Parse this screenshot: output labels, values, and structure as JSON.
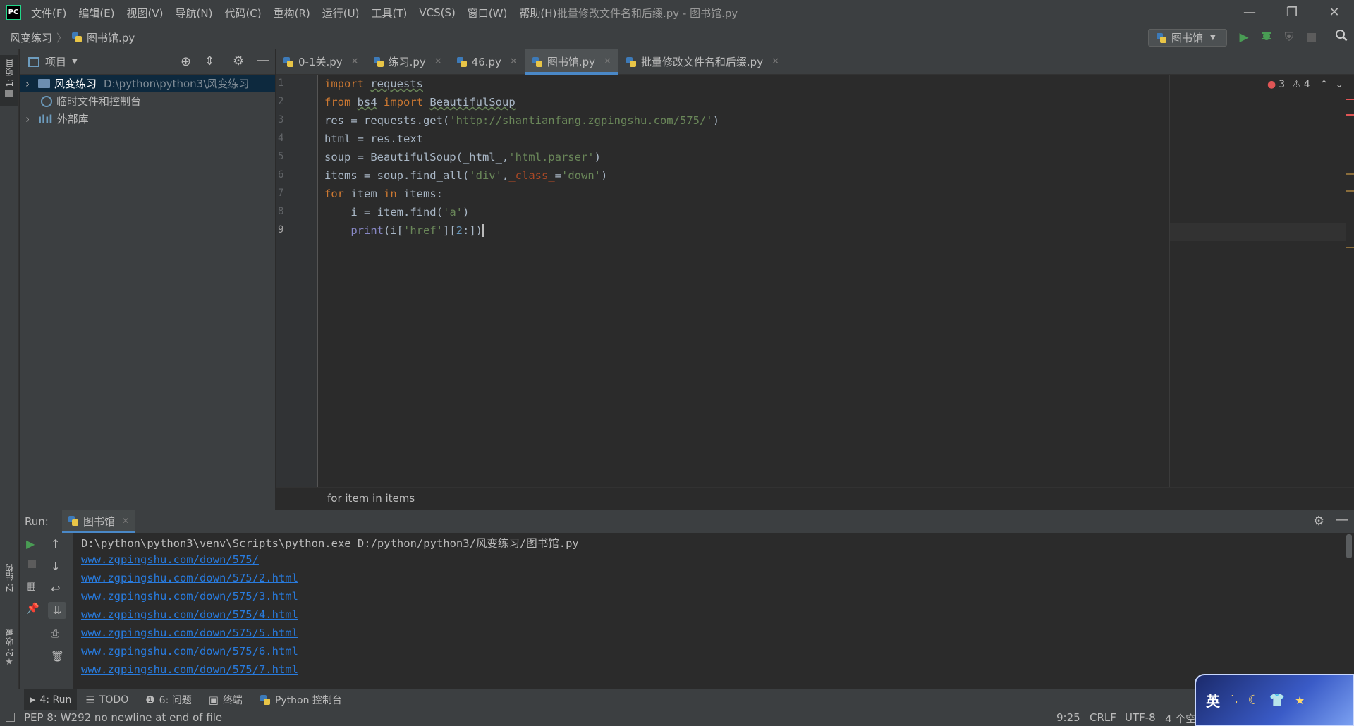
{
  "app": {
    "logo_text": "PC",
    "window_title": "批量修改文件名和后缀.py - 图书馆.py"
  },
  "menu": [
    "文件(F)",
    "编辑(E)",
    "视图(V)",
    "导航(N)",
    "代码(C)",
    "重构(R)",
    "运行(U)",
    "工具(T)",
    "VCS(S)",
    "窗口(W)",
    "帮助(H)"
  ],
  "window_controls": {
    "minimize": "—",
    "restore": "❐",
    "close": "✕"
  },
  "navbar": {
    "project": "风变练习",
    "separator": "〉",
    "file": "图书馆.py",
    "run_config": "图书馆"
  },
  "left_stripe": {
    "project_label": "1: 项目",
    "structure_label": "Z: 结构",
    "favorites_label": "2: 收藏"
  },
  "project_panel": {
    "title": "项目",
    "tree": [
      {
        "label": "风变练习",
        "path": "D:\\python\\python3\\风变练习",
        "arrow": "›",
        "icon": "folder-icon"
      },
      {
        "label": "临时文件和控制台",
        "path": "",
        "arrow": "",
        "icon": "scratch-icon"
      },
      {
        "label": "外部库",
        "path": "",
        "arrow": "›",
        "icon": "library-icon"
      }
    ]
  },
  "tabs": [
    {
      "label": "0-1关.py",
      "active": false
    },
    {
      "label": "练习.py",
      "active": false
    },
    {
      "label": "46.py",
      "active": false
    },
    {
      "label": "图书馆.py",
      "active": true
    },
    {
      "label": "批量修改文件名和后缀.py",
      "active": false
    }
  ],
  "editor": {
    "line_numbers": [
      "1",
      "2",
      "3",
      "4",
      "5",
      "6",
      "7",
      "8",
      "9"
    ],
    "lines": [
      "import requests",
      "from bs4 import BeautifulSoup",
      "res = requests.get('http://shantianfang.zgpingshu.com/575/')",
      "html = res.text",
      "soup = BeautifulSoup(_html_,'html.parser')",
      "items = soup.find_all('div',_class_='down')",
      "for item in items:",
      "    i = item.find('a')",
      "    print(i['href'][2:])"
    ],
    "errors": "3",
    "warnings": "4",
    "breadcrumb": "for item in items"
  },
  "run": {
    "label": "Run:",
    "tab": "图书馆",
    "output": [
      "D:\\python\\python3\\venv\\Scripts\\python.exe D:/python/python3/风变练习/图书馆.py",
      "www.zgpingshu.com/down/575/",
      "www.zgpingshu.com/down/575/2.html",
      "www.zgpingshu.com/down/575/3.html",
      "www.zgpingshu.com/down/575/4.html",
      "www.zgpingshu.com/down/575/5.html",
      "www.zgpingshu.com/down/575/6.html",
      "www.zgpingshu.com/down/575/7.html"
    ]
  },
  "toolwindows": [
    "4: Run",
    "TODO",
    "6: 问题",
    "终端",
    "Python 控制台"
  ],
  "status": {
    "message": "PEP 8: W292 no newline at end of file",
    "position": "9:25",
    "line_sep": "CRLF",
    "encoding": "UTF-8",
    "indent": "4 个空"
  },
  "ime": {
    "lang": "英"
  },
  "colors": {
    "accent": "#4a88c7",
    "run_green": "#499c54",
    "error_red": "#e05555",
    "link_blue": "#287bde"
  }
}
